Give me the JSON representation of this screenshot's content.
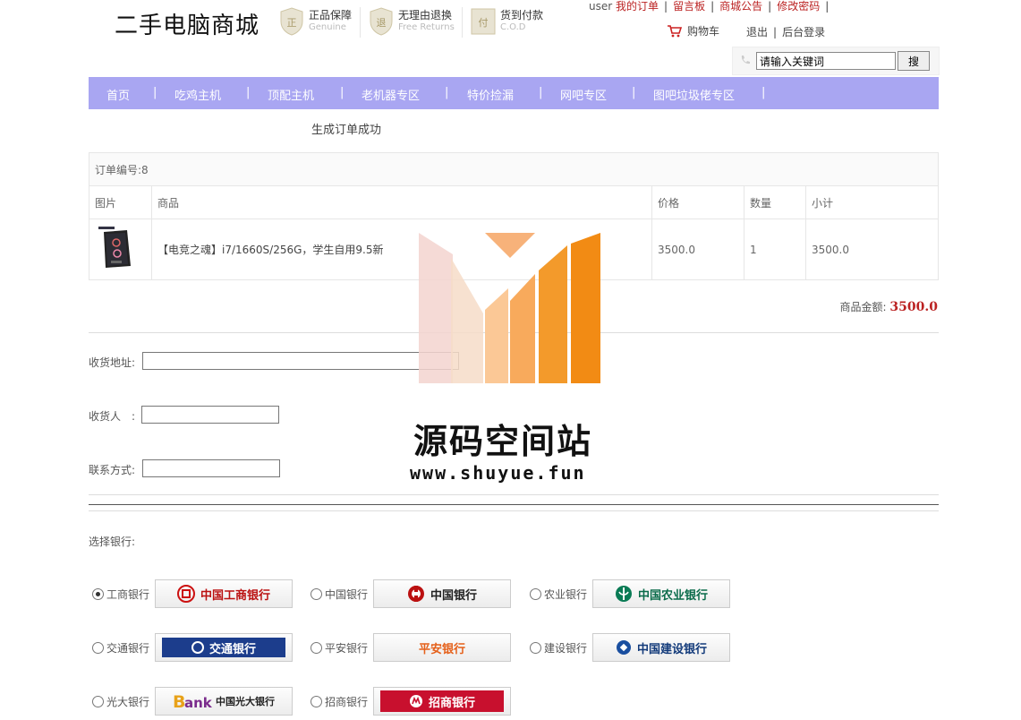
{
  "header": {
    "logo": "二手电脑商城",
    "badges": [
      {
        "title": "正品保障",
        "sub": "Genuine",
        "icon": "正"
      },
      {
        "title": "无理由退换",
        "sub": "Free Returns",
        "icon": "退"
      },
      {
        "title": "货到付款",
        "sub": "C.O.D",
        "icon": "付"
      }
    ],
    "user": "user",
    "links": [
      "我的订单",
      "留言板",
      "商城公告",
      "修改密码"
    ],
    "cart": "购物车",
    "logout": "退出",
    "admin": "后台登录",
    "search": {
      "value": "请输入关键词",
      "button": "搜"
    }
  },
  "nav": [
    "首页",
    "吃鸡主机",
    "顶配主机",
    "老机器专区",
    "特价捡漏",
    "网吧专区",
    "图吧垃圾佬专区"
  ],
  "order": {
    "success": "生成订单成功",
    "number": "订单编号:8",
    "headers": [
      "图片",
      "商品",
      "价格",
      "数量",
      "小计"
    ],
    "row": {
      "name": "【电竞之魂】i7/1660S/256G，学生自用9.5新",
      "price": "3500.0",
      "qty": "1",
      "subtotal": "3500.0"
    },
    "total_label": "商品金额:",
    "total_value": "3500.0"
  },
  "form": {
    "address": "收货地址:",
    "receiver": "收货人　:",
    "phone": "联系方式:"
  },
  "bank_label": "选择银行:",
  "banks": [
    {
      "name": "工商银行",
      "logo": "中国工商银行",
      "selected": true
    },
    {
      "name": "中国银行",
      "logo": "中国银行"
    },
    {
      "name": "农业银行",
      "logo": "中国农业银行"
    },
    {
      "name": "交通银行",
      "logo": "交通银行"
    },
    {
      "name": "平安银行",
      "logo": "平安银行"
    },
    {
      "name": "建设银行",
      "logo": "中国建设银行"
    },
    {
      "name": "光大银行",
      "logo": "中国光大银行"
    },
    {
      "name": "招商银行",
      "logo": "招商银行"
    }
  ],
  "watermark": {
    "text": "源码空间站",
    "url": "www.shuyue.fun"
  },
  "colors": {
    "nav": "#a9a6f2",
    "accent": "#b22222",
    "wm_orange": "#f39a2b"
  }
}
